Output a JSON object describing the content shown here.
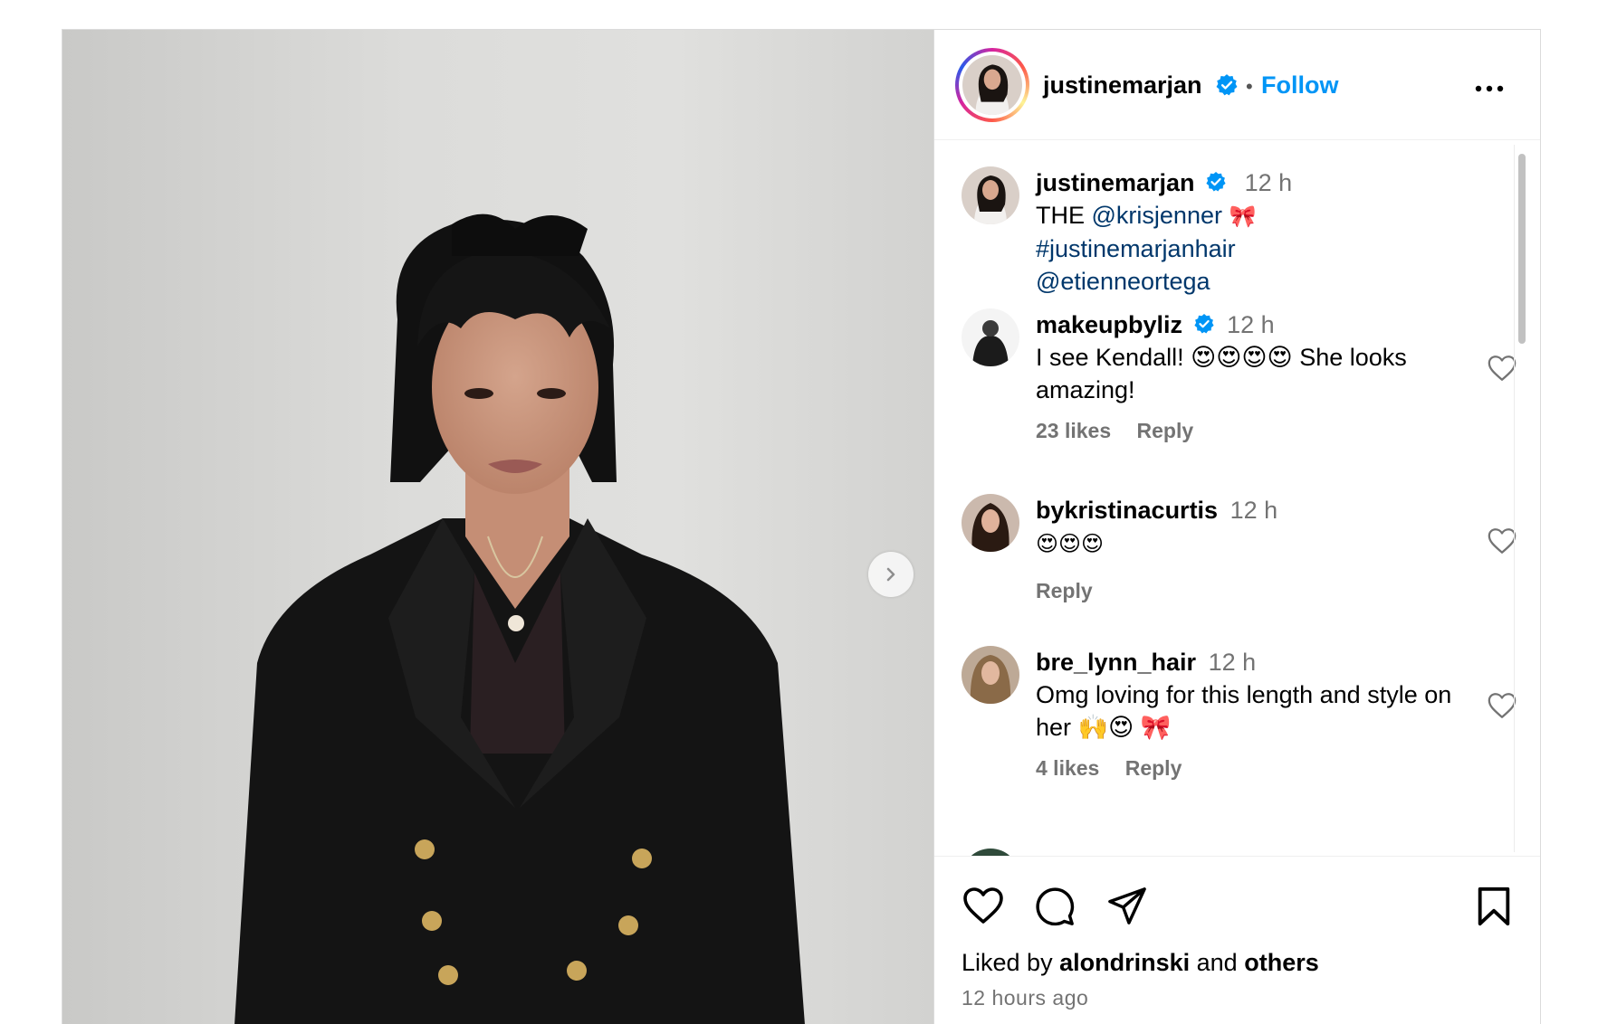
{
  "post": {
    "author": "justinemarjan",
    "follow_label": "Follow",
    "separator": "•"
  },
  "caption": {
    "user": "justinemarjan",
    "time": "12 h",
    "prefix": "THE",
    "mention1": "@krisjenner",
    "emoji": "🎀",
    "hashtag": "#justinemarjanhair",
    "mention2": "@etienneortega"
  },
  "comments": [
    {
      "user": "makeupbyliz",
      "verified": true,
      "time": "12 h",
      "text": "I see Kendall! 😍😍😍😍 She looks amazing!",
      "likes": "23 likes",
      "reply": "Reply"
    },
    {
      "user": "bykristinacurtis",
      "verified": false,
      "time": "12 h",
      "text": "😍😍😍",
      "likes": "",
      "reply": "Reply"
    },
    {
      "user": "bre_lynn_hair",
      "verified": false,
      "time": "12 h",
      "text": "Omg loving for this length and style on her 🙌😍 🎀",
      "likes": "4 likes",
      "reply": "Reply"
    }
  ],
  "footer": {
    "liked_prefix": "Liked by",
    "liked_user": "alondrinski",
    "liked_and": "and",
    "liked_others": "others",
    "time_ago": "12 hours ago"
  },
  "icons": [
    "verified-badge-icon",
    "more-options-icon",
    "next-arrow-icon",
    "heart-icon",
    "comment-icon",
    "share-icon",
    "bookmark-icon"
  ],
  "colors": {
    "link": "#00376b",
    "follow": "#0095f6",
    "verified": "#0095f6",
    "muted": "#737373"
  }
}
